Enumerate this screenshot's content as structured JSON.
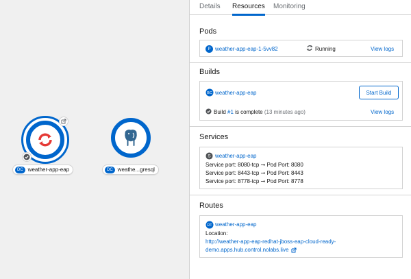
{
  "topology": {
    "nodes": [
      {
        "badge": "DC",
        "label": "weather-app-eap"
      },
      {
        "badge": "DC",
        "label": "weathe...gresql"
      }
    ]
  },
  "tabs": [
    "Details",
    "Resources",
    "Monitoring"
  ],
  "pods": {
    "title": "Pods",
    "badge": "P",
    "name": "weather-app-eap-1-5vv82",
    "status": "Running",
    "view_logs": "View logs"
  },
  "builds": {
    "title": "Builds",
    "name": "weather-app-eap",
    "start_build": "Start Build",
    "status_prefix": "Build",
    "build_number": "#1",
    "status_suffix": "is complete",
    "time": "(13 minutes ago)",
    "view_logs": "View logs"
  },
  "services": {
    "title": "Services",
    "name": "weather-app-eap",
    "ports": [
      {
        "service": "Service port: 8080-tcp",
        "arrow": "➞",
        "pod": "Pod Port: 8080"
      },
      {
        "service": "Service port: 8443-tcp",
        "arrow": "➞",
        "pod": "Pod Port: 8443"
      },
      {
        "service": "Service port: 8778-tcp",
        "arrow": "➞",
        "pod": "Pod Port: 8778"
      }
    ]
  },
  "routes": {
    "title": "Routes",
    "name": "weather-app-eap",
    "location_label": "Location:",
    "url_line1": "http://weather-app-eap-redhat-jboss-eap-cloud-ready-",
    "url_line2": "demo.apps.hub.control.nolabs.live"
  },
  "colors": {
    "accent": "#06c",
    "ring": "#0066cc",
    "openshift_red": "#e53935",
    "postgres_blue": "#336791",
    "success": "#3e8635"
  }
}
